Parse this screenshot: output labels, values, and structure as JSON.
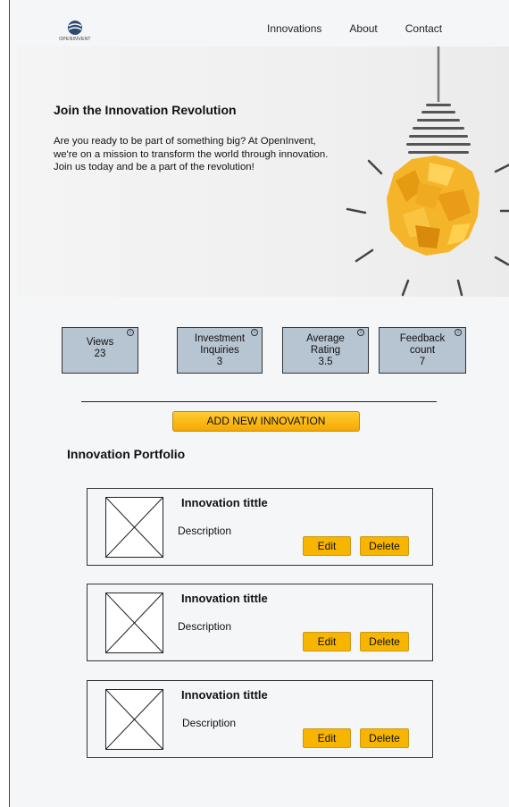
{
  "brand": {
    "logo_text": "OPENINVENT"
  },
  "nav": {
    "items": [
      "Innovations",
      "About",
      "Contact"
    ]
  },
  "hero": {
    "title": "Join the Innovation Revolution",
    "text": "Are you ready to be part of something big? At OpenInvent, we're on a mission to transform the world through innovation. Join us today and be a part of the revolution!"
  },
  "stats": [
    {
      "label": "Views",
      "value": "23"
    },
    {
      "label": "Investment Inquiries",
      "value": "3"
    },
    {
      "label": "Average Rating",
      "value": "3.5"
    },
    {
      "label": "Feedback count",
      "value": "7"
    }
  ],
  "info_glyph": "i",
  "add_button": "ADD NEW INNOVATION",
  "portfolio": {
    "title": "Innovation Portfolio",
    "items": [
      {
        "title": "Innovation tittle",
        "description": "Description",
        "edit": "Edit",
        "delete": "Delete"
      },
      {
        "title": "Innovation tittle",
        "description": "Description",
        "edit": "Edit",
        "delete": "Delete"
      },
      {
        "title": "Innovation tittle",
        "description": "Description",
        "edit": "Edit",
        "delete": "Delete"
      }
    ]
  },
  "colors": {
    "stat_bg": "#b7c4d2",
    "accent": "#f7b500",
    "page_bg": "#f5f6f8"
  }
}
